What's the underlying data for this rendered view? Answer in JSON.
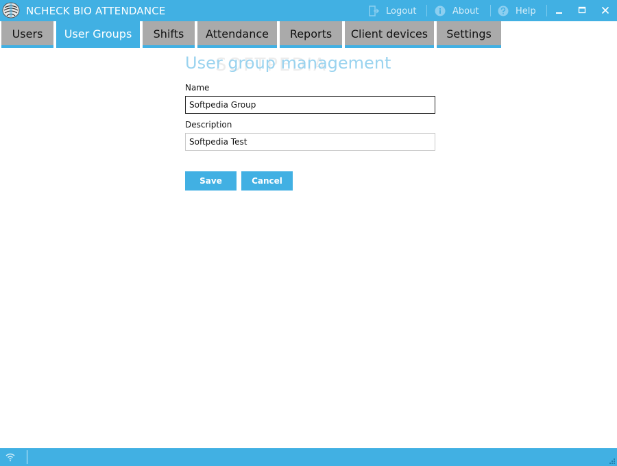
{
  "window": {
    "title": "NCHECK BIO ATTENDANCE",
    "links": {
      "logout": "Logout",
      "about": "About",
      "help": "Help"
    },
    "controls": [
      "minimize",
      "maximize",
      "close"
    ]
  },
  "tabs": [
    {
      "label": "Users",
      "active": false
    },
    {
      "label": "User Groups",
      "active": true
    },
    {
      "label": "Shifts",
      "active": false
    },
    {
      "label": "Attendance",
      "active": false
    },
    {
      "label": "Reports",
      "active": false
    },
    {
      "label": "Client devices",
      "active": false
    },
    {
      "label": "Settings",
      "active": false
    }
  ],
  "main": {
    "title": "User group management",
    "watermark": "SOFTPEDIA",
    "name_label": "Name",
    "name_value": "Softpedia Group",
    "description_label": "Description",
    "description_value": "Softpedia Test",
    "save_label": "Save",
    "cancel_label": "Cancel"
  },
  "colors": {
    "accent": "#41b0e3",
    "tab_inactive": "#aaaaaa",
    "title_text": "#9ad3ef"
  },
  "icons": [
    "app-logo-icon",
    "logout-icon",
    "about-icon",
    "help-icon",
    "wifi-icon",
    "resize-grip-icon"
  ]
}
